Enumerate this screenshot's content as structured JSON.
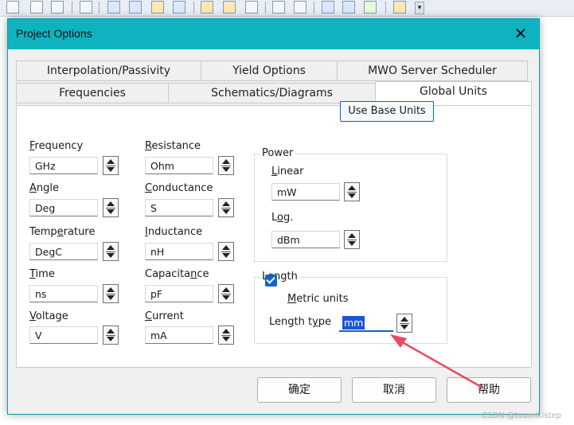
{
  "dialog": {
    "title": "Project Options",
    "close_symbol": "✕"
  },
  "tabs": {
    "row1": [
      "Interpolation/Passivity",
      "Yield Options",
      "MWO Server Scheduler"
    ],
    "row2": [
      "Frequencies",
      "Schematics/Diagrams",
      "Global Units"
    ],
    "active": "Global Units"
  },
  "units": {
    "frequency": {
      "label_u": "F",
      "label_rest": "requency",
      "value": "GHz"
    },
    "angle": {
      "label_u": "A",
      "label_rest": "ngle",
      "value": "Deg"
    },
    "temperature": {
      "label_pre": "Temp",
      "label_u": "e",
      "label_rest": "rature",
      "value": "DegC"
    },
    "time": {
      "label_u": "T",
      "label_rest": "ime",
      "value": "ns"
    },
    "voltage": {
      "label_u": "V",
      "label_rest": "oltage",
      "value": "V"
    },
    "resistance": {
      "label_u": "R",
      "label_rest": "esistance",
      "value": "Ohm"
    },
    "conductance": {
      "label_u": "C",
      "label_rest": "onductance",
      "value": "S"
    },
    "inductance": {
      "label_u": "I",
      "label_rest": "nductance",
      "value": "nH"
    },
    "capacitance": {
      "label_pre": "Capacita",
      "label_u": "n",
      "label_rest": "ce",
      "value": "pF"
    },
    "current": {
      "label_u": "C",
      "label_rest": "urrent",
      "value": "mA"
    }
  },
  "base_units_button": "Use Base Units",
  "power": {
    "title": "Power",
    "linear_label_u": "L",
    "linear_label_rest": "inear",
    "linear_value": "mW",
    "log_label_pre": "L",
    "log_label_u": "o",
    "log_label_rest": "g.",
    "log_value": "dBm"
  },
  "length": {
    "title": "Length",
    "metric_label_u": "M",
    "metric_label_rest": "etric units",
    "metric_checked": true,
    "type_label_pre": "Length t",
    "type_label_u": "y",
    "type_label_rest": "pe",
    "type_value": "mm"
  },
  "buttons": {
    "ok": "确定",
    "cancel": "取消",
    "help": "帮助"
  },
  "watermark": "CSDN @tsumikistep",
  "colors": {
    "titlebar": "#0fb3c0",
    "accent": "#1565c0",
    "arrow": "#ea4a67"
  }
}
